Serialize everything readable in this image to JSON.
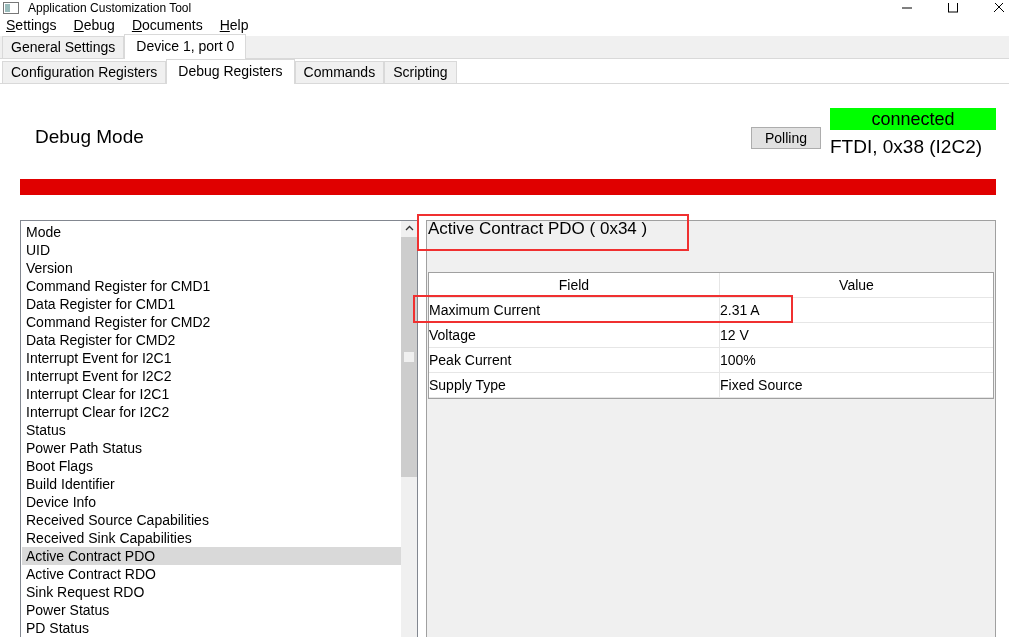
{
  "window": {
    "title": "Application Customization Tool"
  },
  "menu": [
    {
      "label": "Settings"
    },
    {
      "label": "Debug"
    },
    {
      "label": "Documents"
    },
    {
      "label": "Help"
    }
  ],
  "tabs": [
    {
      "label": "General Settings",
      "selected": false
    },
    {
      "label": "Device 1, port 0",
      "selected": true
    }
  ],
  "subtabs": [
    {
      "label": "Configuration Registers",
      "selected": false
    },
    {
      "label": "Debug Registers",
      "selected": true
    },
    {
      "label": "Commands",
      "selected": false
    },
    {
      "label": "Scripting",
      "selected": false
    }
  ],
  "header": {
    "title": "Debug Mode",
    "polling_button": "Polling",
    "status": "connected",
    "connected": true,
    "connection": "FTDI, 0x38 (I2C2)"
  },
  "registers": [
    {
      "label": "Mode",
      "selected": false
    },
    {
      "label": "UID",
      "selected": false
    },
    {
      "label": "Version",
      "selected": false
    },
    {
      "label": "Command Register for CMD1",
      "selected": false
    },
    {
      "label": "Data Register for CMD1",
      "selected": false
    },
    {
      "label": "Command Register for CMD2",
      "selected": false
    },
    {
      "label": "Data Register for CMD2",
      "selected": false
    },
    {
      "label": "Interrupt Event for I2C1",
      "selected": false
    },
    {
      "label": "Interrupt Event for I2C2",
      "selected": false
    },
    {
      "label": "Interrupt Clear for I2C1",
      "selected": false
    },
    {
      "label": "Interrupt Clear for I2C2",
      "selected": false
    },
    {
      "label": "Status",
      "selected": false
    },
    {
      "label": "Power Path Status",
      "selected": false
    },
    {
      "label": "Boot Flags",
      "selected": false
    },
    {
      "label": "Build Identifier",
      "selected": false
    },
    {
      "label": "Device Info",
      "selected": false
    },
    {
      "label": "Received Source Capabilities",
      "selected": false
    },
    {
      "label": "Received Sink Capabilities",
      "selected": false
    },
    {
      "label": "Active Contract PDO",
      "selected": true
    },
    {
      "label": "Active Contract RDO",
      "selected": false
    },
    {
      "label": "Sink Request RDO",
      "selected": false
    },
    {
      "label": "Power Status",
      "selected": false
    },
    {
      "label": "PD Status",
      "selected": false
    }
  ],
  "detail": {
    "title": "Active Contract PDO  ( 0x34 )",
    "title_highlighted": true,
    "columns": [
      "Field",
      "Value"
    ],
    "rows": [
      {
        "field": "Maximum Current",
        "value": "2.31 A",
        "highlighted": true
      },
      {
        "field": "Voltage",
        "value": "12 V",
        "highlighted": false
      },
      {
        "field": "Peak Current",
        "value": "100%",
        "highlighted": false
      },
      {
        "field": "Supply Type",
        "value": "Fixed Source",
        "highlighted": false
      }
    ]
  }
}
